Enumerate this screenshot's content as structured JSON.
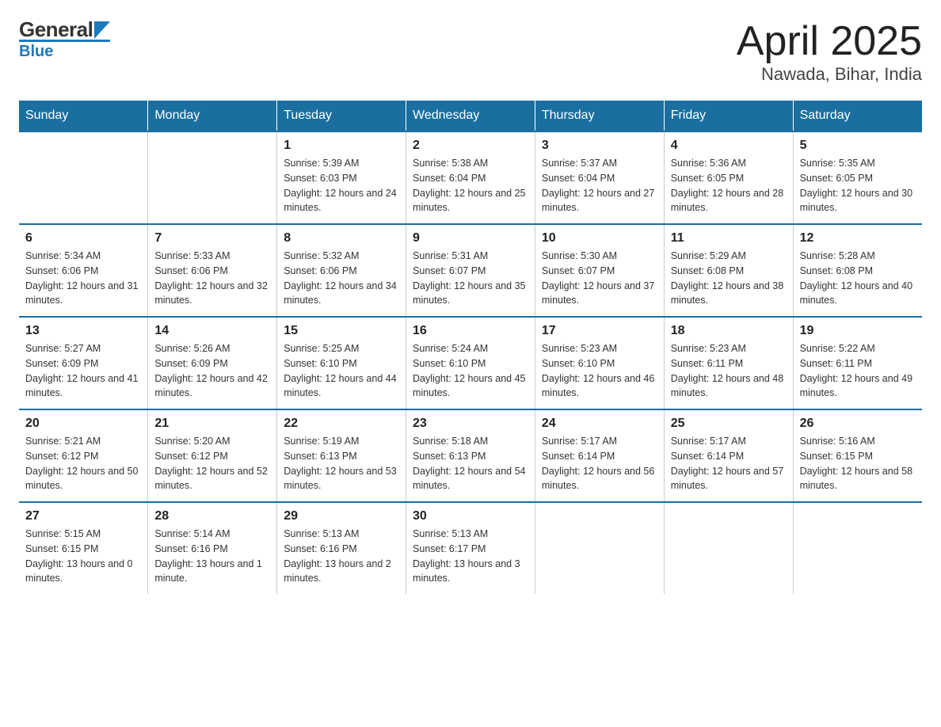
{
  "header": {
    "logo_top": "General",
    "logo_bottom": "Blue",
    "title": "April 2025",
    "subtitle": "Nawada, Bihar, India"
  },
  "calendar": {
    "days_of_week": [
      "Sunday",
      "Monday",
      "Tuesday",
      "Wednesday",
      "Thursday",
      "Friday",
      "Saturday"
    ],
    "weeks": [
      [
        {
          "day": "",
          "info": ""
        },
        {
          "day": "",
          "info": ""
        },
        {
          "day": "1",
          "sunrise": "5:39 AM",
          "sunset": "6:03 PM",
          "daylight": "12 hours and 24 minutes."
        },
        {
          "day": "2",
          "sunrise": "5:38 AM",
          "sunset": "6:04 PM",
          "daylight": "12 hours and 25 minutes."
        },
        {
          "day": "3",
          "sunrise": "5:37 AM",
          "sunset": "6:04 PM",
          "daylight": "12 hours and 27 minutes."
        },
        {
          "day": "4",
          "sunrise": "5:36 AM",
          "sunset": "6:05 PM",
          "daylight": "12 hours and 28 minutes."
        },
        {
          "day": "5",
          "sunrise": "5:35 AM",
          "sunset": "6:05 PM",
          "daylight": "12 hours and 30 minutes."
        }
      ],
      [
        {
          "day": "6",
          "sunrise": "5:34 AM",
          "sunset": "6:06 PM",
          "daylight": "12 hours and 31 minutes."
        },
        {
          "day": "7",
          "sunrise": "5:33 AM",
          "sunset": "6:06 PM",
          "daylight": "12 hours and 32 minutes."
        },
        {
          "day": "8",
          "sunrise": "5:32 AM",
          "sunset": "6:06 PM",
          "daylight": "12 hours and 34 minutes."
        },
        {
          "day": "9",
          "sunrise": "5:31 AM",
          "sunset": "6:07 PM",
          "daylight": "12 hours and 35 minutes."
        },
        {
          "day": "10",
          "sunrise": "5:30 AM",
          "sunset": "6:07 PM",
          "daylight": "12 hours and 37 minutes."
        },
        {
          "day": "11",
          "sunrise": "5:29 AM",
          "sunset": "6:08 PM",
          "daylight": "12 hours and 38 minutes."
        },
        {
          "day": "12",
          "sunrise": "5:28 AM",
          "sunset": "6:08 PM",
          "daylight": "12 hours and 40 minutes."
        }
      ],
      [
        {
          "day": "13",
          "sunrise": "5:27 AM",
          "sunset": "6:09 PM",
          "daylight": "12 hours and 41 minutes."
        },
        {
          "day": "14",
          "sunrise": "5:26 AM",
          "sunset": "6:09 PM",
          "daylight": "12 hours and 42 minutes."
        },
        {
          "day": "15",
          "sunrise": "5:25 AM",
          "sunset": "6:10 PM",
          "daylight": "12 hours and 44 minutes."
        },
        {
          "day": "16",
          "sunrise": "5:24 AM",
          "sunset": "6:10 PM",
          "daylight": "12 hours and 45 minutes."
        },
        {
          "day": "17",
          "sunrise": "5:23 AM",
          "sunset": "6:10 PM",
          "daylight": "12 hours and 46 minutes."
        },
        {
          "day": "18",
          "sunrise": "5:23 AM",
          "sunset": "6:11 PM",
          "daylight": "12 hours and 48 minutes."
        },
        {
          "day": "19",
          "sunrise": "5:22 AM",
          "sunset": "6:11 PM",
          "daylight": "12 hours and 49 minutes."
        }
      ],
      [
        {
          "day": "20",
          "sunrise": "5:21 AM",
          "sunset": "6:12 PM",
          "daylight": "12 hours and 50 minutes."
        },
        {
          "day": "21",
          "sunrise": "5:20 AM",
          "sunset": "6:12 PM",
          "daylight": "12 hours and 52 minutes."
        },
        {
          "day": "22",
          "sunrise": "5:19 AM",
          "sunset": "6:13 PM",
          "daylight": "12 hours and 53 minutes."
        },
        {
          "day": "23",
          "sunrise": "5:18 AM",
          "sunset": "6:13 PM",
          "daylight": "12 hours and 54 minutes."
        },
        {
          "day": "24",
          "sunrise": "5:17 AM",
          "sunset": "6:14 PM",
          "daylight": "12 hours and 56 minutes."
        },
        {
          "day": "25",
          "sunrise": "5:17 AM",
          "sunset": "6:14 PM",
          "daylight": "12 hours and 57 minutes."
        },
        {
          "day": "26",
          "sunrise": "5:16 AM",
          "sunset": "6:15 PM",
          "daylight": "12 hours and 58 minutes."
        }
      ],
      [
        {
          "day": "27",
          "sunrise": "5:15 AM",
          "sunset": "6:15 PM",
          "daylight": "13 hours and 0 minutes."
        },
        {
          "day": "28",
          "sunrise": "5:14 AM",
          "sunset": "6:16 PM",
          "daylight": "13 hours and 1 minute."
        },
        {
          "day": "29",
          "sunrise": "5:13 AM",
          "sunset": "6:16 PM",
          "daylight": "13 hours and 2 minutes."
        },
        {
          "day": "30",
          "sunrise": "5:13 AM",
          "sunset": "6:17 PM",
          "daylight": "13 hours and 3 minutes."
        },
        {
          "day": "",
          "info": ""
        },
        {
          "day": "",
          "info": ""
        },
        {
          "day": "",
          "info": ""
        }
      ]
    ]
  }
}
